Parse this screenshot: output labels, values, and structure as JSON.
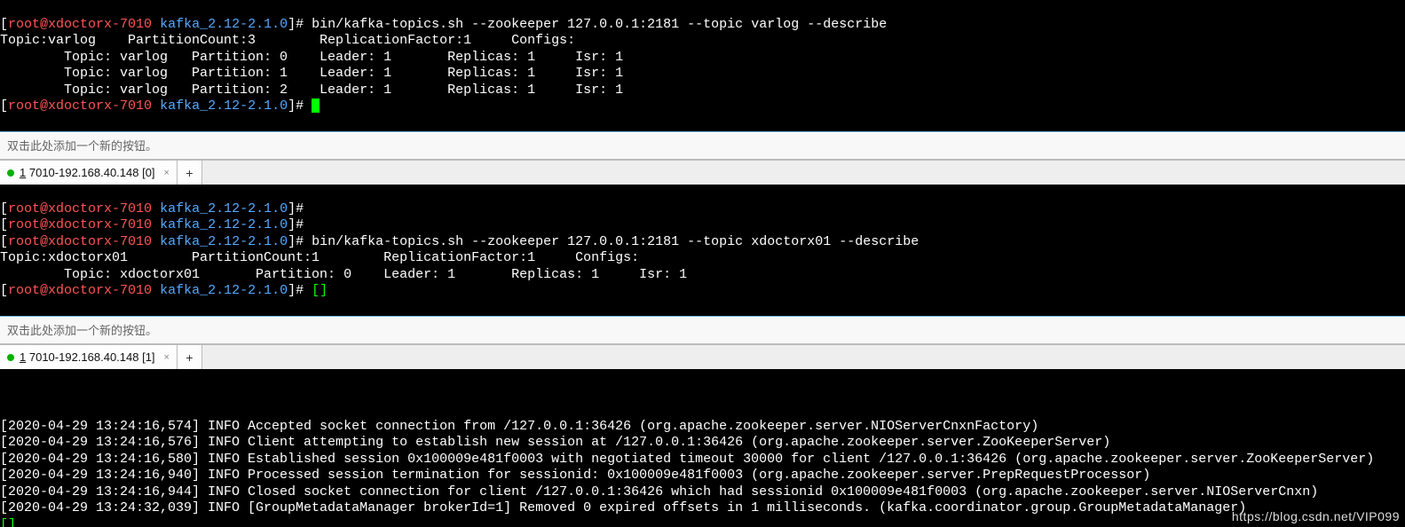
{
  "prompt_user": "root@xdoctorx-7010",
  "prompt_path": "kafka_2.12-2.1.0",
  "hintbar": "双击此处添加一个新的按钮。",
  "tab0": {
    "index": "1",
    "name": "7010-192.168.40.148 [0]",
    "close": "×",
    "add": "+"
  },
  "tab1": {
    "index": "1",
    "name": "7010-192.168.40.148 [1]",
    "close": "×",
    "add": "+"
  },
  "pane1": {
    "cmd": "bin/kafka-topics.sh --zookeeper 127.0.0.1:2181 --topic varlog --describe",
    "l0": "Topic:varlog    PartitionCount:3        ReplicationFactor:1     Configs:",
    "l1": "        Topic: varlog   Partition: 0    Leader: 1       Replicas: 1     Isr: 1",
    "l2": "        Topic: varlog   Partition: 1    Leader: 1       Replicas: 1     Isr: 1",
    "l3": "        Topic: varlog   Partition: 2    Leader: 1       Replicas: 1     Isr: 1"
  },
  "pane2": {
    "cmd": "bin/kafka-topics.sh --zookeeper 127.0.0.1:2181 --topic xdoctorx01 --describe",
    "l0": "Topic:xdoctorx01        PartitionCount:1        ReplicationFactor:1     Configs:",
    "l1": "        Topic: xdoctorx01       Partition: 0    Leader: 1       Replicas: 1     Isr: 1"
  },
  "pane3": {
    "l0": "[2020-04-29 13:24:16,574] INFO Accepted socket connection from /127.0.0.1:36426 (org.apache.zookeeper.server.NIOServerCnxnFactory)",
    "l1": "[2020-04-29 13:24:16,576] INFO Client attempting to establish new session at /127.0.0.1:36426 (org.apache.zookeeper.server.ZooKeeperServer)",
    "l2": "[2020-04-29 13:24:16,580] INFO Established session 0x100009e481f0003 with negotiated timeout 30000 for client /127.0.0.1:36426 (org.apache.zookeeper.server.ZooKeeperServer)",
    "l3": "[2020-04-29 13:24:16,940] INFO Processed session termination for sessionid: 0x100009e481f0003 (org.apache.zookeeper.server.PrepRequestProcessor)",
    "l4": "[2020-04-29 13:24:16,944] INFO Closed socket connection for client /127.0.0.1:36426 which had sessionid 0x100009e481f0003 (org.apache.zookeeper.server.NIOServerCnxn)",
    "l5": "[2020-04-29 13:24:32,039] INFO [GroupMetadataManager brokerId=1] Removed 0 expired offsets in 1 milliseconds. (kafka.coordinator.group.GroupMetadataManager)"
  },
  "watermark": "https://blog.csdn.net/VIP099"
}
